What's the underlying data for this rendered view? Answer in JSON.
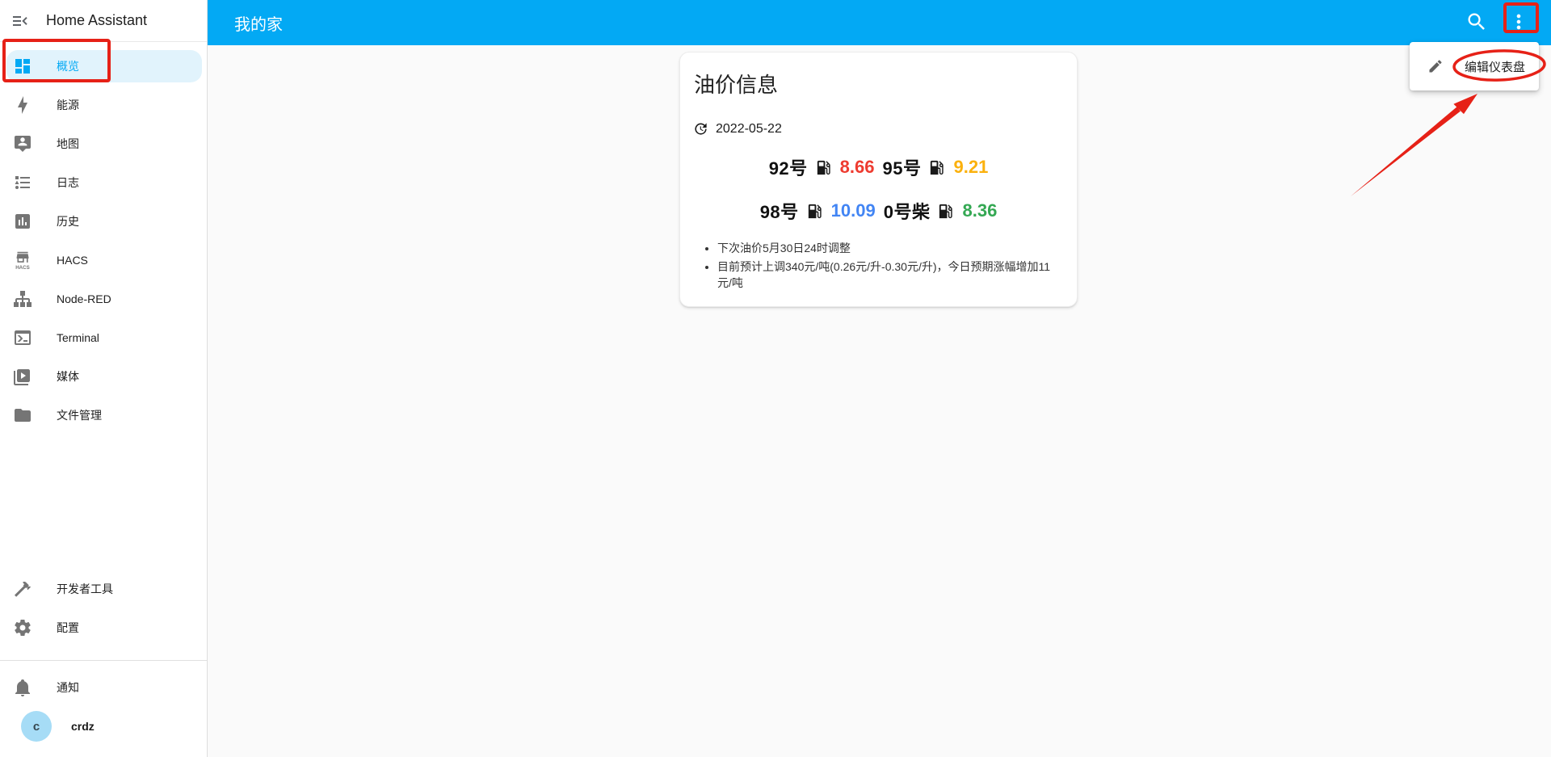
{
  "app": {
    "title": "Home Assistant"
  },
  "topbar": {
    "title": "我的家",
    "search_icon": "magnify",
    "overflow_icon": "dots-vertical"
  },
  "sidebar": {
    "toggle_icon": "menu-toggle",
    "items": [
      {
        "label": "概览",
        "icon": "view-dashboard",
        "selected": true
      },
      {
        "label": "能源",
        "icon": "lightning-bolt"
      },
      {
        "label": "地图",
        "icon": "tooltip-account"
      },
      {
        "label": "日志",
        "icon": "format-list-bulleted-type"
      },
      {
        "label": "历史",
        "icon": "chart-box"
      },
      {
        "label": "HACS",
        "icon": "hacs"
      },
      {
        "label": "Node-RED",
        "icon": "sitemap"
      },
      {
        "label": "Terminal",
        "icon": "console"
      },
      {
        "label": "媒体",
        "icon": "play-box-multiple"
      },
      {
        "label": "文件管理",
        "icon": "folder"
      }
    ],
    "footer_items": [
      {
        "label": "开发者工具",
        "icon": "hammer"
      },
      {
        "label": "配置",
        "icon": "cog"
      }
    ],
    "notifications": {
      "label": "通知",
      "icon": "bell"
    },
    "user": {
      "name": "crdz",
      "avatar_letter": "c"
    }
  },
  "context_menu": {
    "items": [
      {
        "label": "编辑仪表盘",
        "icon": "pencil"
      }
    ]
  },
  "card": {
    "title": "油价信息",
    "date": "2022-05-22",
    "date_icon": "update",
    "fuel_icon": "gas-station",
    "rows": [
      [
        {
          "label": "92号",
          "value": "8.66",
          "color": "#ee3b30"
        },
        {
          "label": "95号",
          "value": "9.21",
          "color": "#fbb10d"
        }
      ],
      [
        {
          "label": "98号",
          "value": "10.09",
          "color": "#4285f4"
        },
        {
          "label": "0号柴",
          "value": "8.36",
          "color": "#34a853"
        }
      ]
    ],
    "notes": [
      "下次油价5月30日24时调整",
      "目前预计上调340元/吨(0.26元/升-0.30元/升)，今日预期涨幅增加11元/吨"
    ]
  },
  "colors": {
    "primary": "#03a9f4",
    "sidebar_selected_bg": "#e1f3fc",
    "annotation": "#e62117",
    "avatar_bg": "#a6dcf6",
    "content_bg": "#fafafa"
  }
}
